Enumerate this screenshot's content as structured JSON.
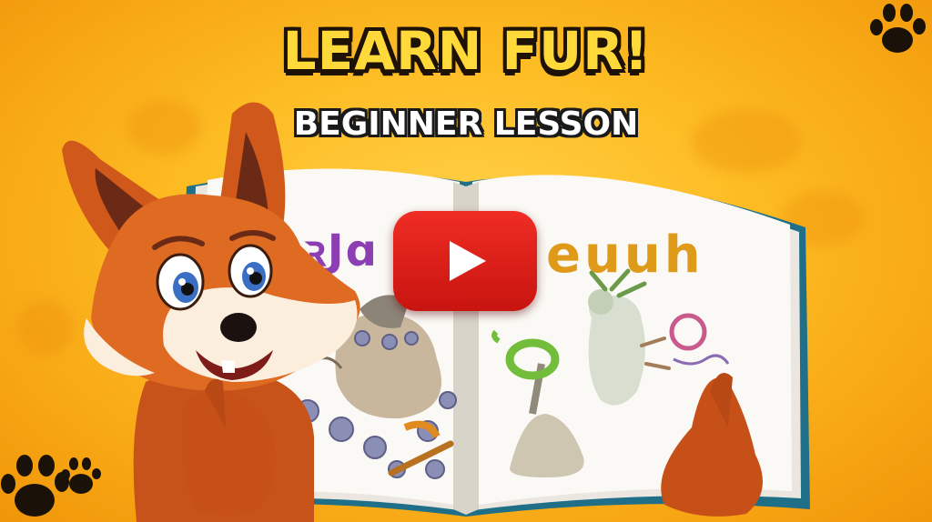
{
  "video": {
    "title_line1": "LEARN FUR!",
    "title_line2": "BEGINNER LESSON",
    "play_button_label": "Play video"
  },
  "book": {
    "left_page_letters": "ꝛJɑ",
    "right_page_letters": "euuh"
  },
  "colors": {
    "background": "#fdbb22",
    "title_fill": "#ffd93a",
    "title_outline": "#1e1206",
    "play_button": "#e0241b",
    "fox_fur": "#d9621f"
  },
  "icons": [
    "paw-print-icon",
    "play-icon"
  ]
}
